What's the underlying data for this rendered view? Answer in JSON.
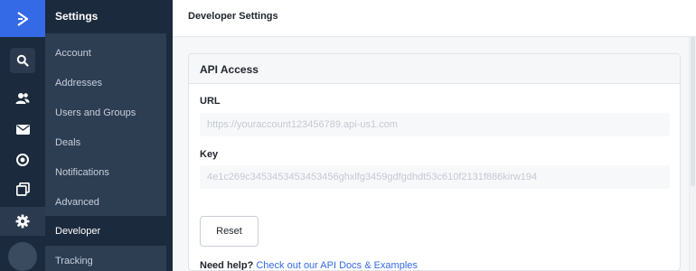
{
  "rail": {
    "icons": [
      "logo-chevron-icon",
      "search-icon",
      "contacts-icon",
      "mail-icon",
      "target-icon",
      "pages-icon",
      "gear-icon",
      "avatar"
    ],
    "active": "gear-icon",
    "brand_color": "#356ae6"
  },
  "sidebar": {
    "title": "Settings",
    "items": [
      {
        "label": "Account"
      },
      {
        "label": "Addresses"
      },
      {
        "label": "Users and Groups"
      },
      {
        "label": "Deals"
      },
      {
        "label": "Notifications"
      },
      {
        "label": "Advanced"
      },
      {
        "label": "Developer",
        "active": true
      },
      {
        "label": "Tracking"
      }
    ]
  },
  "header": {
    "title": "Developer Settings"
  },
  "api": {
    "section_title": "API Access",
    "url_label": "URL",
    "url_value": "https://youraccount123456789.api-us1.com",
    "key_label": "Key",
    "key_value": "4e1c269c3453453453453456ghxlfg3459gdfgdhdt53c610f2131f886kirw194",
    "reset_label": "Reset",
    "help_prefix": "Need help?",
    "help_link": "Check out our API Docs & Examples",
    "link_color": "#356ae6"
  }
}
